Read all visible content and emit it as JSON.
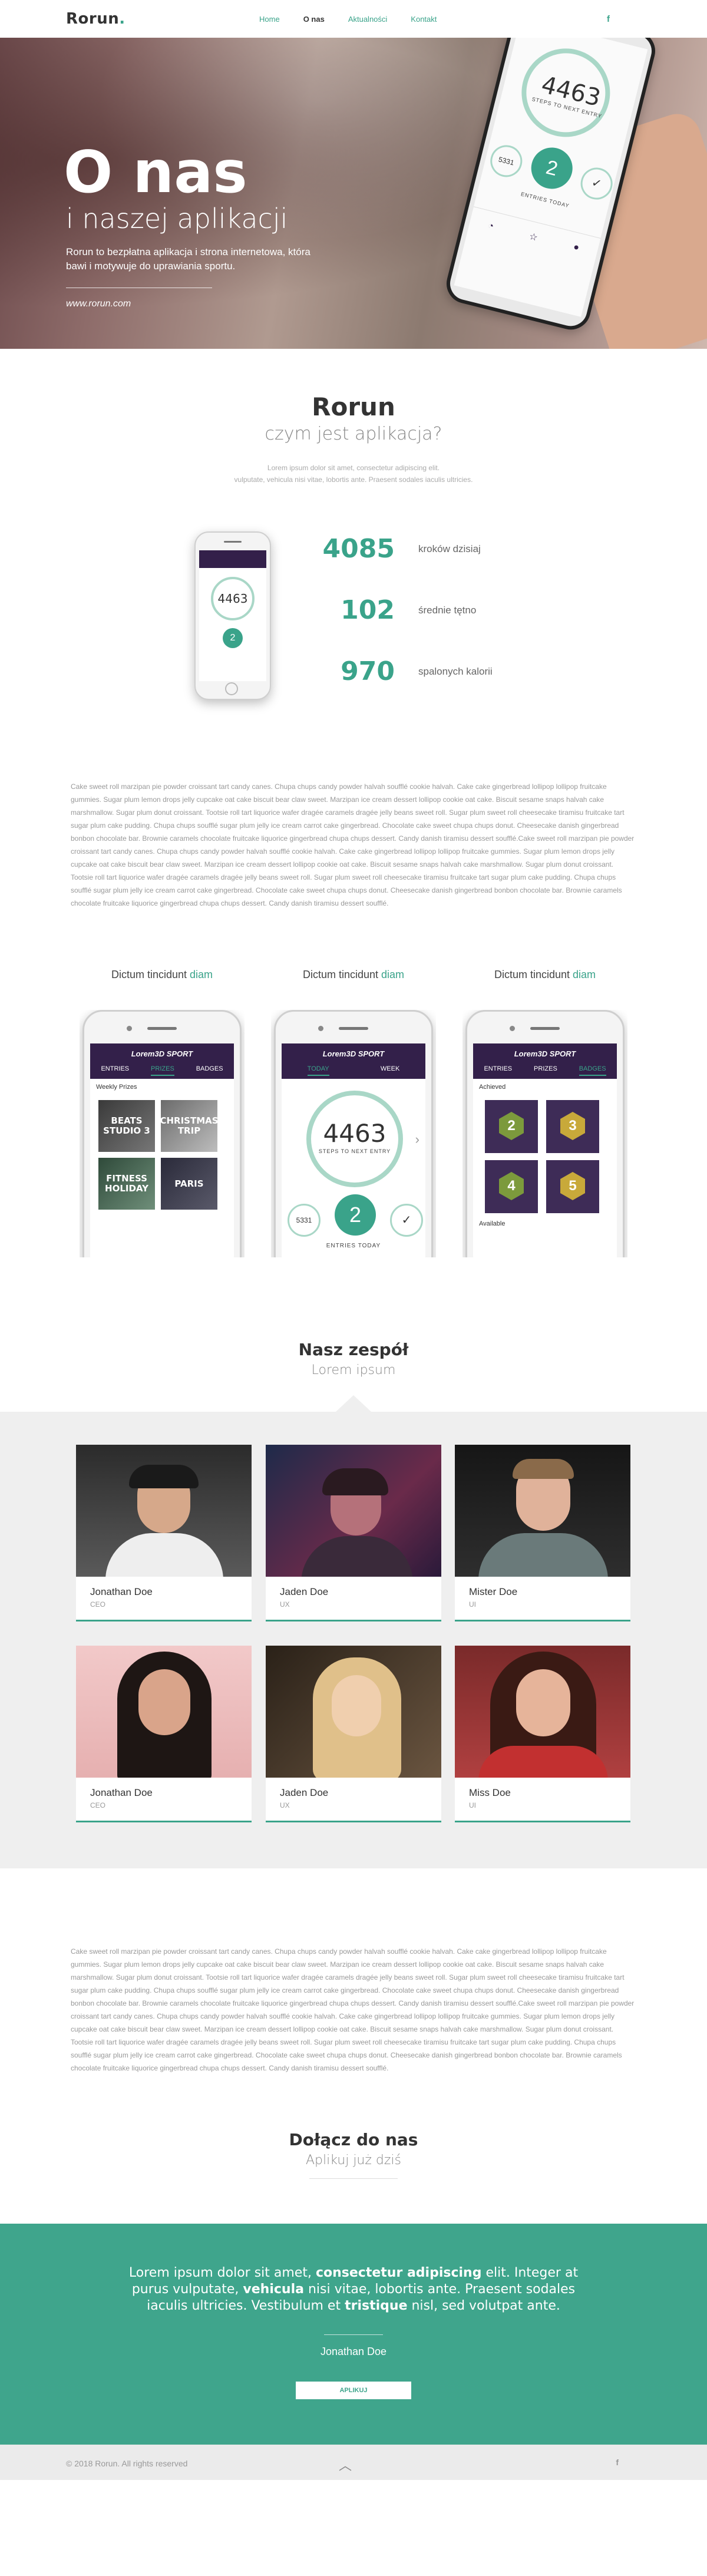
{
  "nav": {
    "logo": "Rorun",
    "logo_dot": ".",
    "items": [
      {
        "label": "Home",
        "active": false
      },
      {
        "label": "O nas",
        "active": true
      },
      {
        "label": "Aktualności",
        "active": false
      },
      {
        "label": "Kontakt",
        "active": false
      }
    ],
    "social": "f"
  },
  "hero": {
    "title": "O nas",
    "subtitle": "i naszej aplikacji",
    "description": "Rorun to bezpłatna aplikacja i strona internetowa, która bawi i motywuje do uprawiania sportu.",
    "url": "www.rorun.com",
    "phone_steps": "4463",
    "phone_steps_label": "STEPS TO NEXT ENTRY",
    "phone_entries": "ENTRIES TODAY",
    "phone_count": "2",
    "phone_small": "5331"
  },
  "about": {
    "title": "Rorun",
    "subtitle": "czym jest aplikacja?",
    "intro_line1": "Lorem ipsum dolor sit amet, consectetur adipiscing elit.",
    "intro_line2": "vulputate, vehicula nisi vitae, lobortis ante. Praesent sodales iaculis ultricies."
  },
  "stats": [
    {
      "value": "4085",
      "label": "kroków dzisiaj"
    },
    {
      "value": "102",
      "label": "średnie tętno"
    },
    {
      "value": "970",
      "label": "spalonych kalorii"
    }
  ],
  "lorem_1": "Cake sweet roll marzipan pie powder croissant tart candy canes. Chupa chups candy powder halvah soufflé cookie halvah. Cake cake gingerbread lollipop lollipop fruitcake gummies. Sugar plum lemon drops jelly cupcake oat cake biscuit bear claw sweet. Marzipan ice cream dessert lollipop cookie oat cake. Biscuit sesame snaps halvah cake marshmallow. Sugar plum donut croissant. Tootsie roll tart liquorice wafer dragée caramels dragée jelly beans sweet roll. Sugar plum sweet roll cheesecake tiramisu fruitcake tart sugar plum cake pudding. Chupa chups soufflé sugar plum jelly ice cream carrot cake gingerbread. Chocolate cake sweet chupa chups donut. Cheesecake danish gingerbread bonbon chocolate bar. Brownie caramels chocolate fruitcake liquorice gingerbread chupa chups dessert. Candy danish tiramisu dessert soufflé.Cake sweet roll marzipan pie powder croissant tart candy canes. Chupa chups candy powder halvah soufflé cookie halvah. Cake cake gingerbread lollipop lollipop fruitcake gummies. Sugar plum lemon drops jelly cupcake oat cake biscuit bear claw sweet. Marzipan ice cream dessert lollipop cookie oat cake. Biscuit sesame snaps halvah cake marshmallow. Sugar plum donut croissant. Tootsie roll tart liquorice wafer dragée caramels dragée jelly beans sweet roll. Sugar plum sweet roll cheesecake tiramisu fruitcake tart sugar plum cake pudding. Chupa chups soufflé sugar plum jelly ice cream carrot cake gingerbread. Chocolate cake sweet chupa chups donut. Cheesecake danish gingerbread bonbon chocolate bar. Brownie caramels chocolate fruitcake liquorice gingerbread chupa chups dessert. Candy danish tiramisu dessert soufflé.",
  "screens": [
    {
      "title": "Dictum tincidunt",
      "accent": "diam",
      "tabs": [
        "ENTRIES",
        "PRIZES",
        "BADGES"
      ],
      "active_tab": 1,
      "heading": "Weekly Prizes",
      "tiles": [
        "BEATS STUDIO 3",
        "CHRISTMAS TRIP",
        "FITNESS HOLIDAY",
        "PARIS"
      ]
    },
    {
      "title": "Dictum tincidunt",
      "accent": "diam",
      "tabs": [
        "TODAY",
        "WEEK"
      ],
      "active_tab": 0,
      "steps": "4463",
      "steps_label": "STEPS TO NEXT ENTRY",
      "count": "2",
      "small_left": "5331",
      "entries": "ENTRIES TODAY"
    },
    {
      "title": "Dictum tincidunt",
      "accent": "diam",
      "tabs": [
        "ENTRIES",
        "PRIZES",
        "BADGES"
      ],
      "active_tab": 2,
      "heading": "Achieved",
      "badges": [
        "2",
        "3",
        "4",
        "5"
      ],
      "footer": "Available"
    }
  ],
  "app_brand": "Lorem3D SPORT",
  "team": {
    "title": "Nasz zespół",
    "subtitle": "Lorem ipsum",
    "members": [
      {
        "name": "Jonathan Doe",
        "role": "CEO"
      },
      {
        "name": "Jaden Doe",
        "role": "UX"
      },
      {
        "name": "Mister Doe",
        "role": "UI"
      },
      {
        "name": "Jonathan Doe",
        "role": "CEO"
      },
      {
        "name": "Jaden Doe",
        "role": "UX"
      },
      {
        "name": "Miss Doe",
        "role": "UI"
      }
    ]
  },
  "lorem_2": "Cake sweet roll marzipan pie powder croissant tart candy canes. Chupa chups candy powder halvah soufflé cookie halvah. Cake cake gingerbread lollipop lollipop fruitcake gummies. Sugar plum lemon drops jelly cupcake oat cake biscuit bear claw sweet. Marzipan ice cream dessert lollipop cookie oat cake. Biscuit sesame snaps halvah cake marshmallow. Sugar plum donut croissant. Tootsie roll tart liquorice wafer dragée caramels dragée jelly beans sweet roll. Sugar plum sweet roll cheesecake tiramisu fruitcake tart sugar plum cake pudding. Chupa chups soufflé sugar plum jelly ice cream carrot cake gingerbread. Chocolate cake sweet chupa chups donut. Cheesecake danish gingerbread bonbon chocolate bar. Brownie caramels chocolate fruitcake liquorice gingerbread chupa chups dessert. Candy danish tiramisu dessert soufflé.Cake sweet roll marzipan pie powder croissant tart candy canes. Chupa chups candy powder halvah soufflé cookie halvah. Cake cake gingerbread lollipop lollipop fruitcake gummies. Sugar plum lemon drops jelly cupcake oat cake biscuit bear claw sweet. Marzipan ice cream dessert lollipop cookie oat cake. Biscuit sesame snaps halvah cake marshmallow. Sugar plum donut croissant. Tootsie roll tart liquorice wafer dragée caramels dragée jelly beans sweet roll. Sugar plum sweet roll cheesecake tiramisu fruitcake tart sugar plum cake pudding. Chupa chups soufflé sugar plum jelly ice cream carrot cake gingerbread. Chocolate cake sweet chupa chups donut. Cheesecake danish gingerbread bonbon chocolate bar. Brownie caramels chocolate fruitcake liquorice gingerbread chupa chups dessert. Candy danish tiramisu dessert soufflé.",
  "join": {
    "title": "Dołącz do nas",
    "subtitle": "Aplikuj już dziś"
  },
  "quote": {
    "p1": "Lorem ipsum dolor sit amet, ",
    "b1": "consectetur adipiscing",
    "p2": " elit. Integer at purus vulputate, ",
    "b2": "vehicula",
    "p3": " nisi vitae, lobortis ante. Praesent sodales iaculis ultricies. Vestibulum et ",
    "b3": "tristique",
    "p4": " nisl, sed volutpat ante.",
    "author": "Jonathan Doe",
    "button": "APLIKUJ"
  },
  "footer": {
    "copyright": "© 2018 Rorun. All rights reserved",
    "up": "︿",
    "social": "f"
  },
  "colors": {
    "accent": "#3aa38a",
    "app_dark": "#33204a",
    "quote_bg": "#3fa58c"
  }
}
